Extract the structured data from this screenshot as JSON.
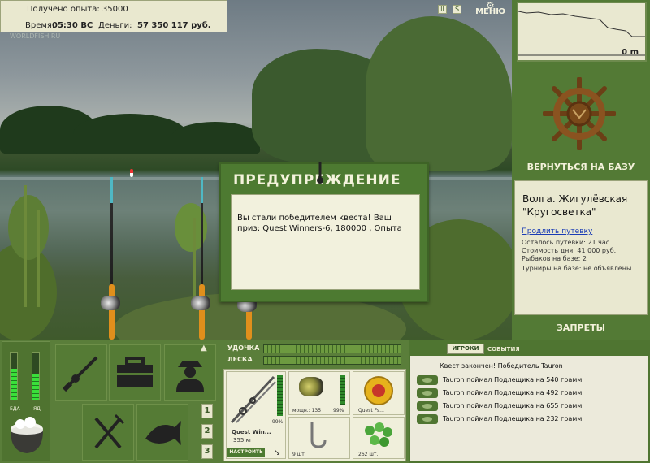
{
  "info": {
    "experience": "Получено опыта: 35000",
    "time_label": "Время:",
    "time_value": "05:30 ВС",
    "money_label": "Деньги:",
    "money_value": "57 350 117 руб.",
    "logo": "WORLDFISH.RU"
  },
  "controls": {
    "pause_glyph": "II",
    "sound_glyph": "S",
    "menu_label": "МЕНЮ"
  },
  "depth": {
    "value": "0 m"
  },
  "base": {
    "return_label": "ВЕРНУТЬСЯ НА БАЗУ",
    "name": "Волга. Жигулёвская \"Кругосветка\"",
    "extend_link": "Продлить путевку",
    "remaining": "Осталось путевки: 21 час.",
    "cost": "Стоимость дня: 41 000 руб.",
    "fishers": "Рыбаков на базе: 2",
    "tournaments": "Турниры на базе: не объявлены",
    "restrictions_label": "ЗАПРЕТЫ"
  },
  "dialog": {
    "title": "ПРЕДУПРЕЖДЕНИЕ",
    "message": "Вы стали победителем квеста! Ваш приз: Quest Winners-6, 180000 , Опыта"
  },
  "stats": {
    "food_label": "ЕДА",
    "poison_label": "ЯД",
    "food_level": 0.65,
    "poison_level": 0.55
  },
  "slots": [
    "1",
    "2",
    "3"
  ],
  "tackle": {
    "rod_label": "УДОЧКА",
    "line_label": "ЛЕСКА",
    "rod_name": "Quest Win...",
    "rod_weight": "355 кг",
    "rod_condition": "99%",
    "reel_power": "мощн.: 135",
    "reel_condition": "99%",
    "line_name": "Quest Fs...",
    "hooks_count": "9 шт.",
    "bait_count": "262 шт.",
    "setup_label": "НАСТРОИТЬ"
  },
  "events": {
    "tab_players": "ИГРОКИ",
    "tab_events": "СОБЫТИЯ",
    "header": "Квест закончен! Победитель Tauron",
    "items": [
      "Tauron поймал Подлещика на 540 грамм",
      "Tauron поймал Подлещика на 492 грамм",
      "Tauron поймал Подлещика на 655 грамм",
      "Tauron поймал Подлещика на 232 грамм"
    ]
  },
  "icons": {
    "rod_tile": "fishing-rod-icon",
    "tackle_box": "tackle-box-icon",
    "fisherman": "fisherman-icon",
    "cutlery": "cutlery-icon",
    "fish": "fish-icon",
    "helm": "ship-wheel-icon",
    "pot": "pot-icon"
  },
  "colors": {
    "panel_green": "#537a35",
    "cream": "#e9e8d0",
    "link_blue": "#1a3cb5"
  }
}
